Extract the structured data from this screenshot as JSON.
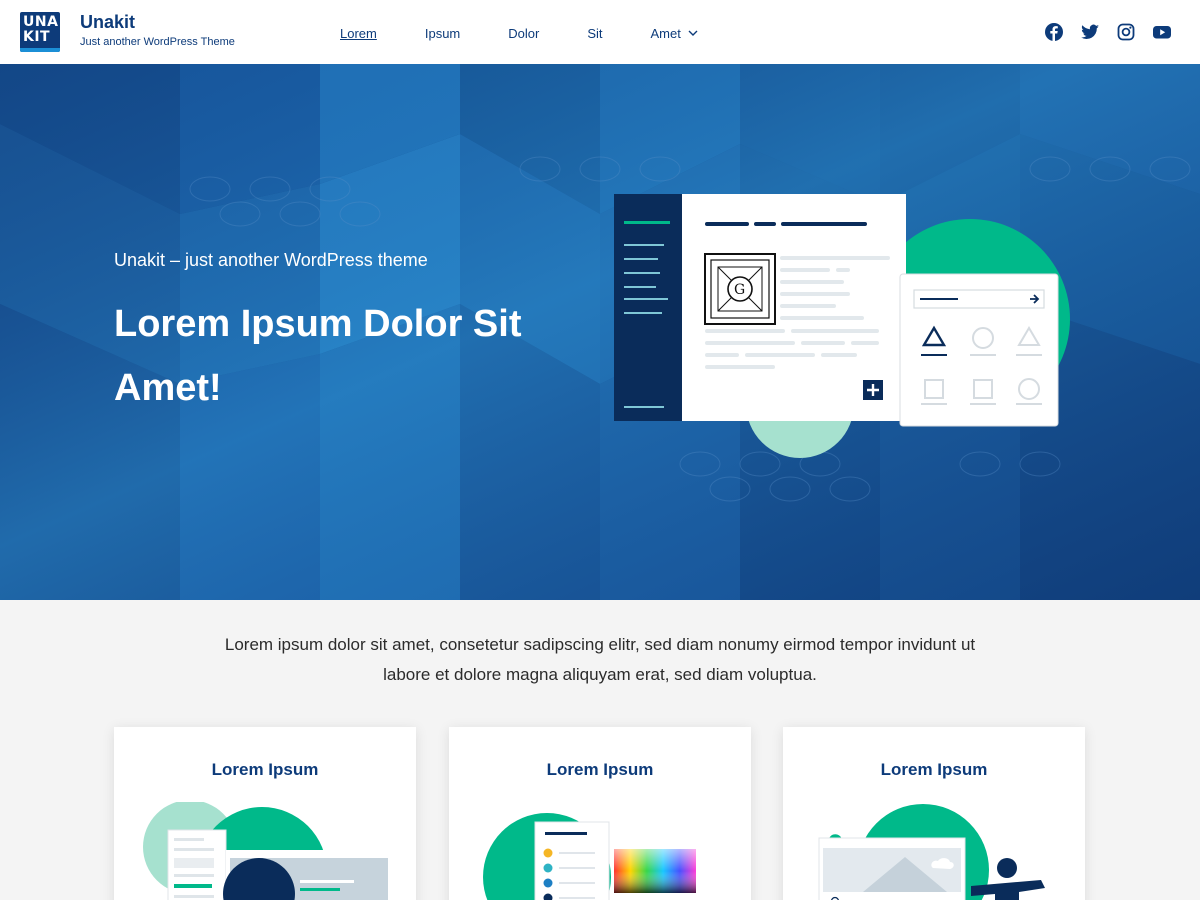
{
  "header": {
    "logo": {
      "line1": "UNA",
      "line2": "KIT"
    },
    "title": "Unakit",
    "tagline": "Just another WordPress Theme",
    "nav": [
      {
        "label": "Lorem",
        "active": true
      },
      {
        "label": "Ipsum"
      },
      {
        "label": "Dolor"
      },
      {
        "label": "Sit"
      },
      {
        "label": "Amet",
        "has_dropdown": true
      }
    ],
    "social": [
      "facebook-icon",
      "twitter-icon",
      "instagram-icon",
      "youtube-icon"
    ]
  },
  "hero": {
    "subtitle": "Unakit – just another WordPress theme",
    "title": "Lorem Ipsum Dolor Sit Amet!"
  },
  "intro": {
    "text": "Lorem ipsum dolor sit amet, consetetur sadipscing elitr, sed diam nonumy eirmod tempor invidunt ut labore et dolore magna aliquyam erat, sed diam voluptua."
  },
  "cards": [
    {
      "title": "Lorem Ipsum"
    },
    {
      "title": "Lorem Ipsum"
    },
    {
      "title": "Lorem Ipsum"
    }
  ],
  "colors": {
    "brand": "#0d3b7a",
    "accent_green": "#00b98a",
    "hero_bg": "#0e3a7a",
    "page_bg": "#f4f4f4"
  }
}
